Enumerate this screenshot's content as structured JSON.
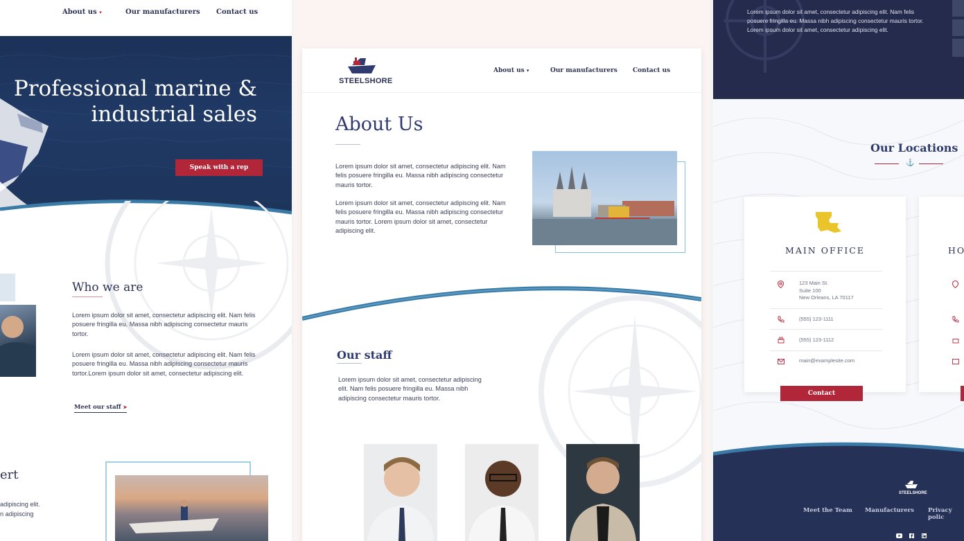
{
  "nav": {
    "about": "About us",
    "about_caret": "▾",
    "manufacturers": "Our manufacturers",
    "contact": "Contact us"
  },
  "left": {
    "hero_line1": "Professional marine &",
    "hero_line2": "industrial sales",
    "cta": "Speak with a rep",
    "who_title": "Who we are",
    "who_p1": "Lorem ipsum dolor sit amet, consectetur adipiscing elit. Nam felis posuere fringilla eu. Massa nibh adipiscing consectetur mauris tortor.",
    "who_p2": "Lorem ipsum dolor sit amet, consectetur adipiscing elit. Nam felis posuere fringilla eu. Massa nibh adipiscing consectetur mauris tortor.Lorem ipsum dolor sit amet, consectetur adipiscing elit.",
    "meet_link": "Meet our staff",
    "meet_arrow": "➤",
    "expert_fragment": "ert",
    "expert_line1": "adipiscing elit.",
    "expert_line2": "n adipiscing"
  },
  "middle": {
    "logo_text": "STEELSHORE",
    "about_title": "About Us",
    "about_p1": "Lorem ipsum dolor sit amet, consectetur adipiscing elit. Nam felis posuere fringilla eu. Massa nibh adipiscing consectetur mauris tortor.",
    "about_p2": "Lorem ipsum dolor sit amet, consectetur adipiscing elit. Nam felis posuere fringilla eu. Massa nibh adipiscing consectetur mauris tortor. Lorem ipsum dolor sit amet, consectetur adipiscing elit.",
    "staff_title": "Our staff",
    "staff_p": "Lorem ipsum dolor sit amet, consectetur adipiscing elit. Nam felis posuere fringilla eu. Massa nibh adipiscing consectetur mauris tortor."
  },
  "right": {
    "top_p": "Lorem ipsum dolor sit amet, consectetur adipiscing elit. Nam felis posuere fringilla eu. Massa nibh adipiscing consectetur mauris tortor. Lorem ipsum dolor sit amet, consectetur adipiscing elit.",
    "locations_title": "Our Locations",
    "anchor": "⚓",
    "office_title": "MAIN OFFICE",
    "second_title_fragment": "HO",
    "address_line1": "123 Main St.",
    "address_line2": "Suite 100",
    "address_line3": "New Orleans, LA 70117",
    "phone": "(555) 123-1111",
    "fax": "(555) 123-1112",
    "email": "main@examplesite.com",
    "contact_button": "Contact",
    "footer_logo": "STEELSHORE",
    "footer_links": [
      "Meet the Team",
      "Manufacturers",
      "Privacy polic"
    ]
  },
  "colors": {
    "navy": "#2b3152",
    "crimson": "#b2263a",
    "teal": "#3a7aa6",
    "gold": "#e9c52b"
  }
}
